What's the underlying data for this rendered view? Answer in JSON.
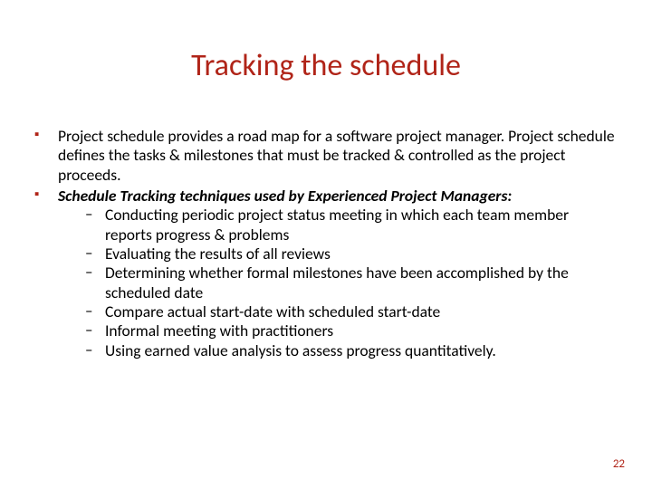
{
  "title": "Tracking the schedule",
  "bullets": {
    "b1": "Project schedule provides a road map for a software project manager. Project schedule defines the tasks & milestones that must be tracked & controlled as the project proceeds.",
    "b2": "Schedule Tracking techniques used by Experienced Project Managers:",
    "sub": {
      "s1": "Conducting periodic project status meeting in which each team member reports  progress & problems",
      "s2": "Evaluating  the results of all reviews",
      "s3": "Determining whether formal milestones have been accomplished by the scheduled date",
      "s4": "Compare actual start-date with scheduled start-date",
      "s5": "Informal meeting with practitioners",
      "s6": "Using earned value analysis to assess progress quantitatively."
    }
  },
  "pagenum": "22"
}
